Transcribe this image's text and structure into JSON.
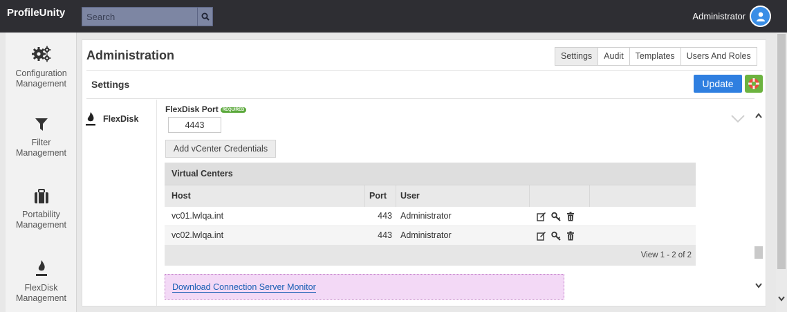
{
  "app": {
    "brand": "ProfileUnity"
  },
  "search": {
    "placeholder": "Search"
  },
  "user": {
    "name": "Administrator"
  },
  "sidebar": {
    "items": [
      {
        "line1": "Configuration",
        "line2": "Management",
        "icon": "gears-icon"
      },
      {
        "line1": "Filter",
        "line2": "Management",
        "icon": "filter-icon"
      },
      {
        "line1": "Portability",
        "line2": "Management",
        "icon": "briefcase-icon"
      },
      {
        "line1": "FlexDisk",
        "line2": "Management",
        "icon": "flexdisk-icon"
      }
    ]
  },
  "page": {
    "title": "Administration",
    "section": "Settings"
  },
  "tabs": [
    {
      "label": "Settings",
      "active": true
    },
    {
      "label": "Audit"
    },
    {
      "label": "Templates"
    },
    {
      "label": "Users And Roles"
    }
  ],
  "actions": {
    "update_label": "Update"
  },
  "flexdisk": {
    "label": "FlexDisk",
    "port_label": "FlexDisk Port",
    "required_badge": "REQUIRED",
    "port_value": "4443",
    "add_vcenter_label": "Add vCenter Credentials"
  },
  "grid": {
    "caption": "Virtual Centers",
    "columns": {
      "host": "Host",
      "port": "Port",
      "user": "User"
    },
    "rows": [
      {
        "host": "vc01.lwlqa.int",
        "port": "443",
        "user": "Administrator"
      },
      {
        "host": "vc02.lwlqa.int",
        "port": "443",
        "user": "Administrator"
      }
    ],
    "footer": "View 1 - 2 of 2"
  },
  "download": {
    "label": "Download Connection Server Monitor"
  },
  "colors": {
    "topbar": "#2e2e33",
    "accent": "#2f7fe0",
    "download_bg": "#f3d9f6",
    "required": "#5aa83a"
  }
}
